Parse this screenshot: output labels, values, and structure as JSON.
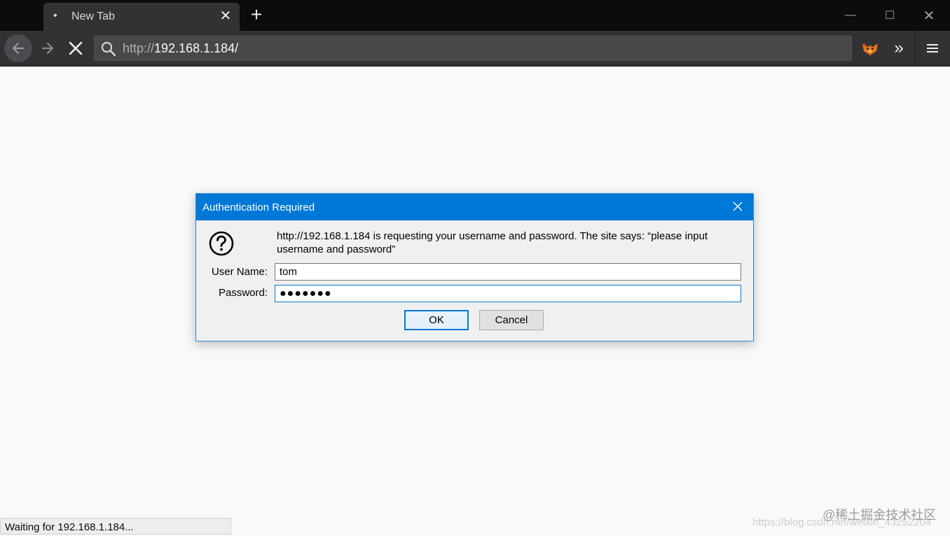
{
  "window": {
    "tab_title": "New Tab",
    "tab_dot": "•",
    "minimize": "—",
    "maximize": "☐",
    "close": "✕"
  },
  "navigation": {
    "url_prefix": "http://",
    "url_host": "192.168.1.184/"
  },
  "dialog": {
    "title": "Authentication Required",
    "message": "http://192.168.1.184 is requesting your username and password. The site says: “please input username and password”",
    "username_label": "User Name:",
    "username_value": "tom",
    "password_label": "Password:",
    "password_value": "●●●●●●●",
    "ok_label": "OK",
    "cancel_label": "Cancel"
  },
  "status": {
    "text": "Waiting for 192.168.1.184..."
  },
  "watermark": {
    "main": "@稀土掘金技术社区",
    "sub": "https://blog.csdn.net/weixin_43252204"
  },
  "colors": {
    "dialog_title_bg": "#0078d7",
    "chrome_bg": "#0c0c0d",
    "toolbar_bg": "#323234"
  }
}
